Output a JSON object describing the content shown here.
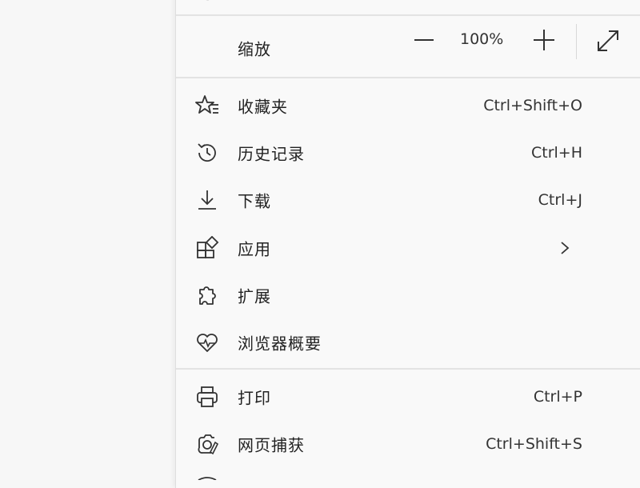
{
  "zoom": {
    "label": "缩放",
    "value": "100%"
  },
  "items": [
    {
      "label": "收藏夹",
      "shortcut": "Ctrl+Shift+O",
      "icon": "favorites-star-icon"
    },
    {
      "label": "历史记录",
      "shortcut": "Ctrl+H",
      "icon": "history-icon"
    },
    {
      "label": "下载",
      "shortcut": "Ctrl+J",
      "icon": "download-icon"
    },
    {
      "label": "应用",
      "shortcut": "",
      "icon": "apps-icon"
    },
    {
      "label": "扩展",
      "shortcut": "",
      "icon": "extensions-icon"
    },
    {
      "label": "浏览器概要",
      "shortcut": "",
      "icon": "browser-essentials-icon"
    },
    {
      "label": "打印",
      "shortcut": "Ctrl+P",
      "icon": "print-icon"
    },
    {
      "label": "网页捕获",
      "shortcut": "Ctrl+Shift+S",
      "icon": "web-capture-icon"
    }
  ],
  "colors": {
    "menu_bg": "#f9f9f9",
    "divider": "#e3e3e3",
    "text": "#222222"
  }
}
